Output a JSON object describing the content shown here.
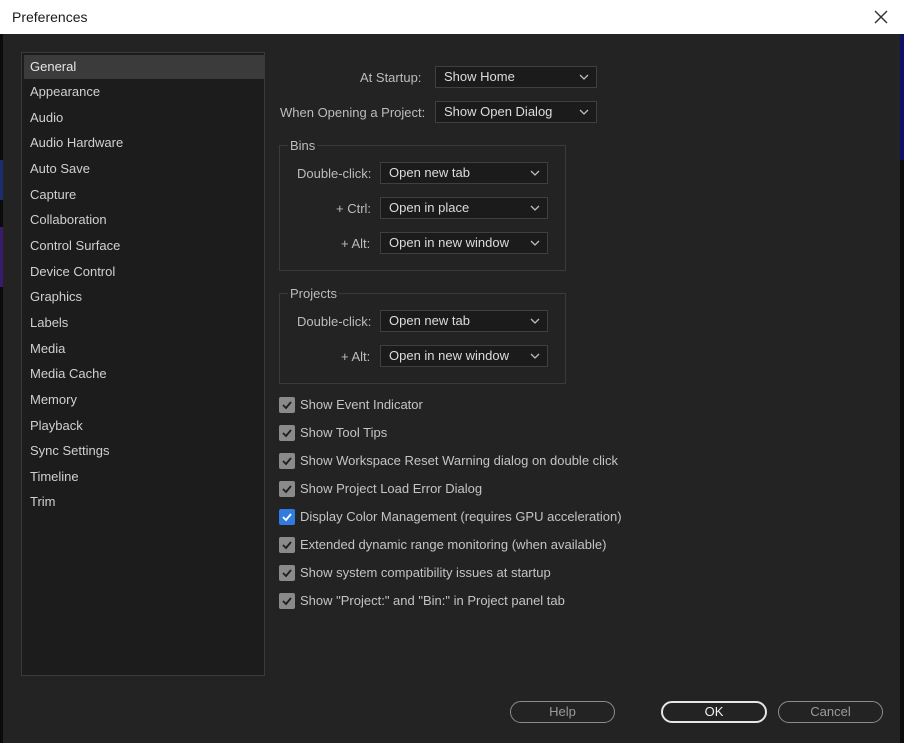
{
  "window": {
    "title": "Preferences"
  },
  "sidebar": {
    "items": [
      {
        "label": "General",
        "selected": true
      },
      {
        "label": "Appearance"
      },
      {
        "label": "Audio"
      },
      {
        "label": "Audio Hardware"
      },
      {
        "label": "Auto Save"
      },
      {
        "label": "Capture"
      },
      {
        "label": "Collaboration"
      },
      {
        "label": "Control Surface"
      },
      {
        "label": "Device Control"
      },
      {
        "label": "Graphics"
      },
      {
        "label": "Labels"
      },
      {
        "label": "Media"
      },
      {
        "label": "Media Cache"
      },
      {
        "label": "Memory"
      },
      {
        "label": "Playback"
      },
      {
        "label": "Sync Settings"
      },
      {
        "label": "Timeline"
      },
      {
        "label": "Trim"
      }
    ]
  },
  "general": {
    "at_startup": {
      "label": "At Startup:",
      "value": "Show Home"
    },
    "opening_project": {
      "label": "When Opening a Project:",
      "value": "Show Open Dialog"
    },
    "bins": {
      "title": "Bins",
      "double_click": {
        "label": "Double-click:",
        "value": "Open new tab"
      },
      "ctrl": {
        "label": "+ Ctrl:",
        "value": "Open in place"
      },
      "alt": {
        "label": "+ Alt:",
        "value": "Open in new window"
      }
    },
    "projects": {
      "title": "Projects",
      "double_click": {
        "label": "Double-click:",
        "value": "Open new tab"
      },
      "alt": {
        "label": "+ Alt:",
        "value": "Open in new window"
      }
    },
    "checkboxes": [
      {
        "label": "Show Event Indicator",
        "checked": true
      },
      {
        "label": "Show Tool Tips",
        "checked": true
      },
      {
        "label": "Show Workspace Reset Warning dialog on double click",
        "checked": true
      },
      {
        "label": "Show Project Load Error Dialog",
        "checked": true
      },
      {
        "label": "Display Color Management (requires GPU acceleration)",
        "checked": true,
        "accent": "#2f7be0"
      },
      {
        "label": "Extended dynamic range monitoring (when available)",
        "checked": true
      },
      {
        "label": "Show system compatibility issues at startup",
        "checked": true
      },
      {
        "label": "Show \"Project:\" and \"Bin:\" in Project panel tab",
        "checked": true
      }
    ]
  },
  "footer": {
    "help": "Help",
    "ok": "OK",
    "cancel": "Cancel"
  },
  "colors": {
    "background": "#232323",
    "accent": "#2f7be0",
    "checkbox": "#8a8a8a"
  }
}
